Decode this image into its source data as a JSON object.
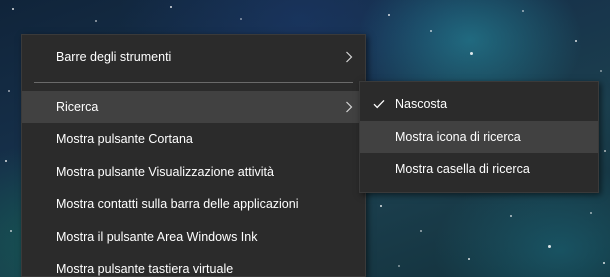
{
  "context_menu": {
    "items": [
      {
        "label": "Barre degli strumenti"
      },
      {
        "label": "Ricerca"
      },
      {
        "label": "Mostra pulsante Cortana"
      },
      {
        "label": "Mostra pulsante Visualizzazione attività"
      },
      {
        "label": "Mostra contatti sulla barra delle applicazioni"
      },
      {
        "label": "Mostra il pulsante Area Windows Ink"
      },
      {
        "label": "Mostra pulsante tastiera virtuale"
      }
    ]
  },
  "submenu": {
    "items": [
      {
        "label": "Nascosta",
        "checked": true
      },
      {
        "label": "Mostra icona di ricerca",
        "hovered": true
      },
      {
        "label": "Mostra casella di ricerca"
      }
    ]
  },
  "colors": {
    "menu_bg": "#2b2b2b",
    "hover_bg": "#414141",
    "text": "#ffffff"
  }
}
